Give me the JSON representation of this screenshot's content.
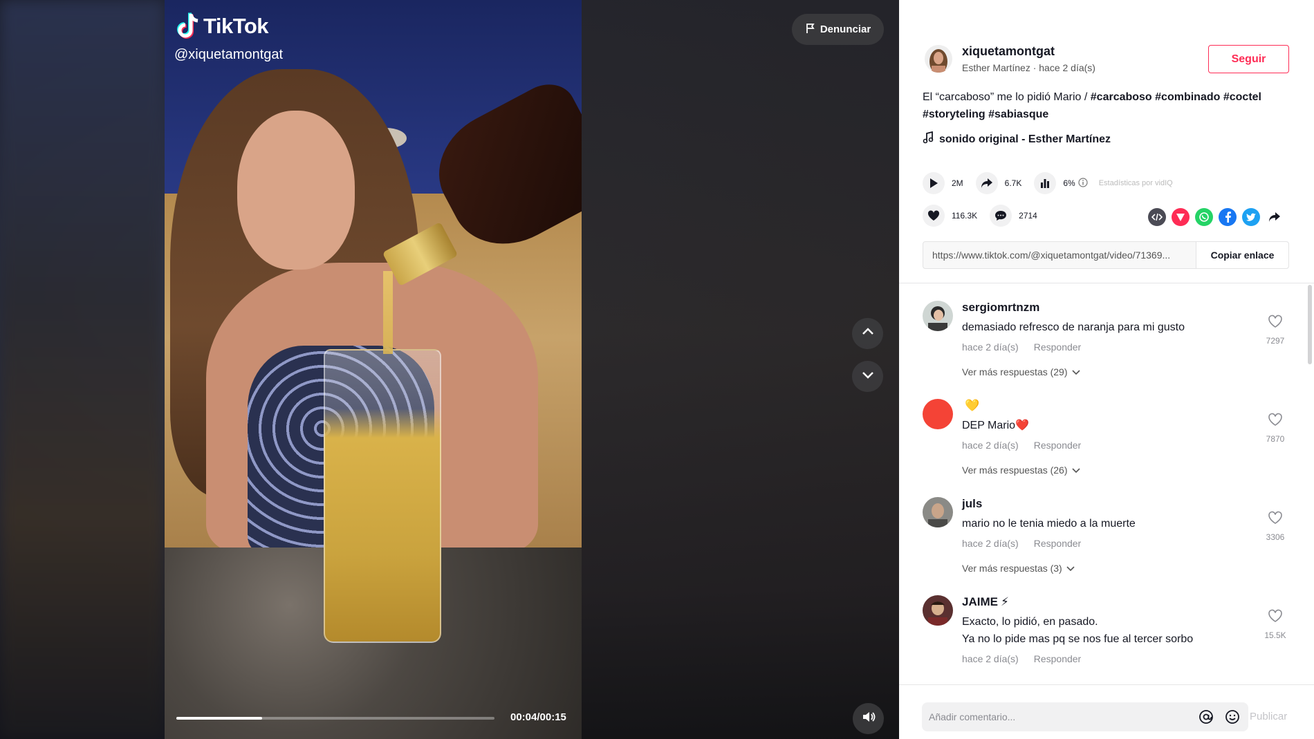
{
  "video": {
    "brand": "TikTok",
    "handle": "@xiquetamontgat",
    "current_time": "00:04",
    "duration": "00:15",
    "timecode": "00:04/00:15",
    "progress_fraction": 0.27,
    "report_label": "Denunciar"
  },
  "author": {
    "username": "xiquetamontgat",
    "subtitle": "Esther Martínez · hace 2 día(s)",
    "follow_label": "Seguir"
  },
  "caption": {
    "text": "El “carcaboso” me lo pidió Mario / ",
    "hashtags": [
      "#carcaboso",
      "#combinado",
      "#coctel",
      "#storyteling",
      "#sabiasque"
    ]
  },
  "sound": "sonido original - Esther Martínez",
  "stats": {
    "plays": "2M",
    "shares": "6.7K",
    "engagement": "6%",
    "vidiq_label": "Estadísticas por vidIQ",
    "likes": "116.3K",
    "comments": "2714"
  },
  "share_icons": [
    "embed-icon",
    "send-icon",
    "whatsapp-icon",
    "facebook-icon",
    "twitter-icon",
    "share-arrow-icon"
  ],
  "link": {
    "url": "https://www.tiktok.com/@xiquetamontgat/video/71369...",
    "copy_label": "Copiar enlace"
  },
  "comments": [
    {
      "user": "sergiomrtnzm",
      "user_emoji": "",
      "text": "demasiado refresco de naranja para mi gusto",
      "time": "hace 2 día(s)",
      "reply": "Responder",
      "more": "Ver más respuestas (29)",
      "likes": "7297"
    },
    {
      "user": "",
      "user_emoji": "💛",
      "text": "DEP Mario❤️",
      "time": "hace 2 día(s)",
      "reply": "Responder",
      "more": "Ver más respuestas (26)",
      "likes": "7870"
    },
    {
      "user": "juls",
      "user_emoji": "",
      "text": "mario no le tenia miedo a la muerte",
      "time": "hace 2 día(s)",
      "reply": "Responder",
      "more": "Ver más respuestas (3)",
      "likes": "3306"
    },
    {
      "user": "JAIME",
      "user_emoji": "⚡",
      "text": "Exacto, lo pidió, en pasado.",
      "text2": "Ya no lo pide mas pq se nos fue al tercer sorbo",
      "time": "hace 2 día(s)",
      "reply": "Responder",
      "more": "",
      "likes": "15.5K"
    }
  ],
  "comment_box": {
    "placeholder": "Añadir comentario...",
    "publish_label": "Publicar"
  },
  "colors": {
    "accent": "#fe2c55",
    "text": "#161823",
    "muted": "#8a8b91"
  }
}
